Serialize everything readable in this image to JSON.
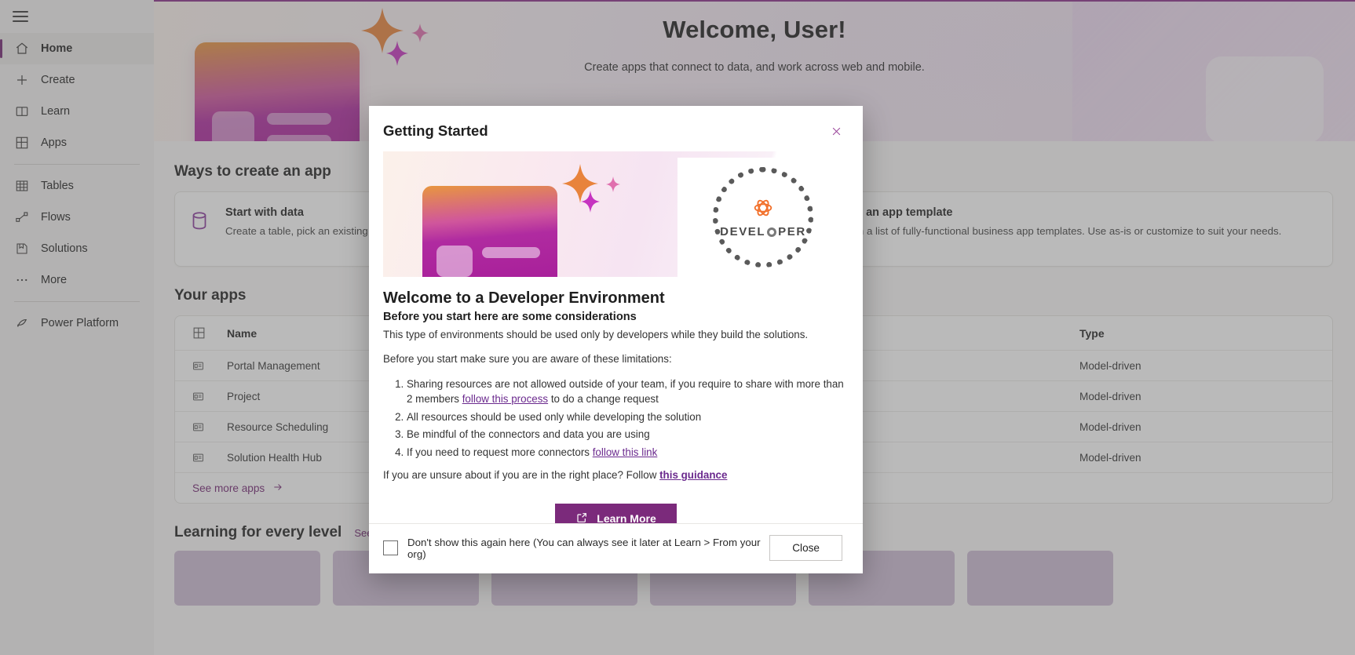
{
  "sidebar": {
    "menu_icon": "hamburger-icon",
    "items": [
      {
        "label": "Home",
        "icon": "home-icon",
        "active": true
      },
      {
        "label": "Create",
        "icon": "plus-icon",
        "active": false
      },
      {
        "label": "Learn",
        "icon": "book-icon",
        "active": false
      },
      {
        "label": "Apps",
        "icon": "apps-grid-icon",
        "active": false
      },
      {
        "label": "Tables",
        "icon": "table-icon",
        "active": false
      },
      {
        "label": "Flows",
        "icon": "flow-icon",
        "active": false
      },
      {
        "label": "Solutions",
        "icon": "solutions-icon",
        "active": false
      },
      {
        "label": "More",
        "icon": "ellipsis-icon",
        "active": false
      },
      {
        "label": "Power Platform",
        "icon": "power-platform-icon",
        "active": false
      }
    ]
  },
  "hero": {
    "title": "Welcome, User!",
    "subtitle": "Create apps that connect to data, and work across web and mobile."
  },
  "ways_section": {
    "title": "Ways to create an app",
    "cards": [
      {
        "title": "Start with data",
        "desc": "Create a table, pick an existing one, from Excel to create an app.",
        "icon": "database-icon"
      },
      {
        "title": "Start with an app template",
        "desc": "Select from a list of fully-functional business app templates. Use as-is or customize to suit your needs.",
        "icon": "template-icon"
      }
    ]
  },
  "your_apps": {
    "title": "Your apps",
    "columns": {
      "name": "Name",
      "type": "Type"
    },
    "rows": [
      {
        "name": "Portal Management",
        "type": "Model-driven"
      },
      {
        "name": "Project",
        "type": "Model-driven"
      },
      {
        "name": "Resource Scheduling",
        "type": "Model-driven"
      },
      {
        "name": "Solution Health Hub",
        "type": "Model-driven"
      }
    ],
    "see_more": "See more apps"
  },
  "learning": {
    "title": "Learning for every level",
    "see_all": "See all"
  },
  "modal": {
    "title": "Getting Started",
    "close_icon": "close-x-icon",
    "badge_word_left": "DEVEL",
    "badge_word_right": "PER",
    "heading": "Welcome to a Developer Environment",
    "subheading": "Before you start here are some considerations",
    "intro": "This type of environments should be used only by developers while they build the solutions.",
    "limitations_lead": "Before you start make sure you are aware of these limitations:",
    "limitations": [
      {
        "pre": "Sharing resources are not allowed outside of your team, if you require to share with more than 2 members ",
        "link": "follow this process",
        "post": " to do a change request"
      },
      {
        "pre": "All resources should be used only while developing the solution",
        "link": "",
        "post": ""
      },
      {
        "pre": "Be mindful of the connectors and data you are using",
        "link": "",
        "post": ""
      },
      {
        "pre": "If you need to request more connectors ",
        "link": "follow this link",
        "post": ""
      }
    ],
    "guidance_pre": "If you are unsure about if you are in the right place? Follow ",
    "guidance_link": "this guidance",
    "learn_more_label": "Learn More",
    "learn_more_icon": "external-link-icon",
    "dont_show_label": "Don't show this again here (You can always see it later at Learn > From your org)",
    "close_label": "Close"
  },
  "colors": {
    "brand_purple": "#742774",
    "button_purple": "#7b2a7b",
    "link_purple": "#6b2a8e",
    "accent_orange": "#f2712c"
  }
}
